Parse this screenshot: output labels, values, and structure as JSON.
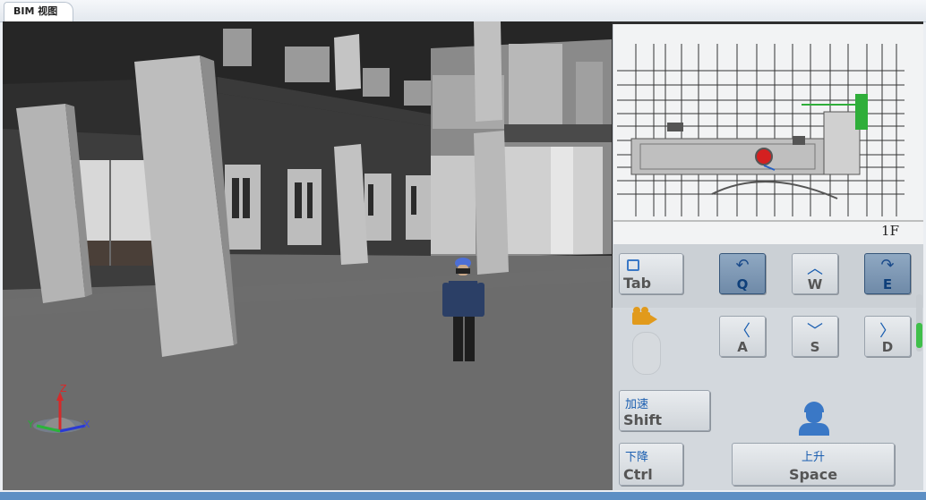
{
  "tab": {
    "label": "BIM 视图"
  },
  "minimap": {
    "floor_label": "1F"
  },
  "keys": {
    "tab": "Tab",
    "q": "Q",
    "w": "W",
    "e": "E",
    "a": "A",
    "s": "S",
    "d": "D",
    "accelerate_cn": "加速",
    "shift": "Shift",
    "descend_cn": "下降",
    "ctrl": "Ctrl",
    "ascend_cn": "上升",
    "space": "Space"
  },
  "axis": {
    "x": "X",
    "y": "Y",
    "z": "Z"
  },
  "colors": {
    "accent": "#1a5eb0",
    "status_bar": "#5d8fc4",
    "camera_icon": "#e19a1c",
    "person_icon": "#3a78c6"
  }
}
